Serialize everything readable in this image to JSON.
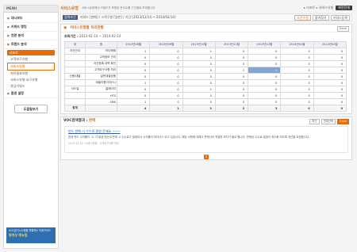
{
  "sidebar": {
    "title": "MENU",
    "nav": [
      {
        "label": "대시보드"
      },
      {
        "label": "키워드 랭킹"
      },
      {
        "label": "연관 분석"
      }
    ],
    "open_section": {
      "label": "트렌드 분석",
      "sub_head": "리포트",
      "items": [
        {
          "label": "고객보구유형"
        },
        {
          "label": "서비스유형"
        },
        {
          "label": "처리결과유형"
        },
        {
          "label": "서비스유형-요구유형"
        },
        {
          "label": "관심키워드"
        }
      ]
    },
    "settings": {
      "label": "환경 설정"
    },
    "help_button": "도움말보기",
    "promo": {
      "line1": "VOC분석시스템을 활용하는 이용가이드",
      "line2": "동영상 매뉴얼"
    }
  },
  "header": {
    "title": "서비스유형",
    "description": "서비스유형에서 키워드가 포함된 문서수를 기간별로 보여줍니다",
    "breadcrumb": "▸ 리포트 ▸ 서비스유형",
    "window_btn": "화면전체"
  },
  "filter": {
    "label": "검색조건",
    "text": "키워드 [판매] / 고객구분 [일반] / 기간 [2013/12/14 ~ 2014/02/14]",
    "btn_modify": "조건수정",
    "btn_save": "즐겨찾기",
    "btn_register": "키워드등록"
  },
  "panel": {
    "title": "서비스유형별 처리현황",
    "excel": "Excel",
    "period_label": "조회기간 :",
    "period": "2013-02-14 ~ 2014-02-14"
  },
  "table": {
    "headers": [
      "대",
      "중",
      "2013년08월",
      "2013년09월",
      "2013년10월",
      "2013년11월",
      "2013년12월",
      "2014년01월",
      "2014년02월"
    ],
    "rows": [
      {
        "cat": "자산관리",
        "sub": "기타/해제",
        "v": [
          1,
          0,
          1,
          0,
          0,
          0,
          0
        ]
      },
      {
        "cat": "",
        "sub": "고객정보 관리",
        "v": [
          0,
          0,
          0,
          0,
          0,
          0,
          0
        ]
      },
      {
        "cat": "",
        "sub": "자산등록 내역 확인",
        "v": [
          0,
          0,
          0,
          0,
          0,
          0,
          0
        ]
      },
      {
        "cat": "",
        "sub": "고객요구사항 처리",
        "v": [
          0,
          0,
          0,
          1,
          1,
          0,
          0
        ]
      },
      {
        "cat": "신용/대출",
        "sub": "일반대출상품",
        "v": [
          0,
          0,
          0,
          0,
          0,
          0,
          0
        ]
      },
      {
        "cat": "",
        "sub": "대출이용이자(%)",
        "v": [
          1,
          0,
          0,
          0,
          0,
          0,
          0
        ]
      },
      {
        "cat": "서드절",
        "sub": "홈페이지",
        "v": [
          0,
          0,
          1,
          0,
          0,
          0,
          0
        ]
      },
      {
        "cat": "",
        "sub": "HTS",
        "v": [
          0,
          0,
          0,
          0,
          0,
          0,
          0
        ]
      },
      {
        "cat": "",
        "sub": "SMS",
        "v": [
          1,
          0,
          0,
          0,
          0,
          0,
          0
        ]
      },
      {
        "cat": "합계",
        "sub": "",
        "v": [
          4,
          1,
          3,
          2,
          3,
          0,
          0
        ],
        "total": true
      }
    ],
    "highlight": {
      "row": 3,
      "col": 4
    }
  },
  "voc": {
    "title_prefix": "VOC검색결과 :",
    "keyword": "판매",
    "sort": "최근",
    "tools": [
      "전체선택",
      "Excel"
    ],
    "item": {
      "title": "펀드 판매 시 수수료 환원 문제요 ~~~",
      "body": "현재 펀드 수익률이 -% 가 발생 되는데 판매 시 수수료가 발생되서 수익률이 마이너스 되고 있습니다. 해당 사항에 대해서 판매사의 적절한 조치가 필요 합니다. 판매된 수수료 발생이 최소화 되도록 개선을 요청합니다.",
      "meta": "2013-12-15 | 서비스유형 : 고객요구사항 처리"
    },
    "page": "1"
  }
}
